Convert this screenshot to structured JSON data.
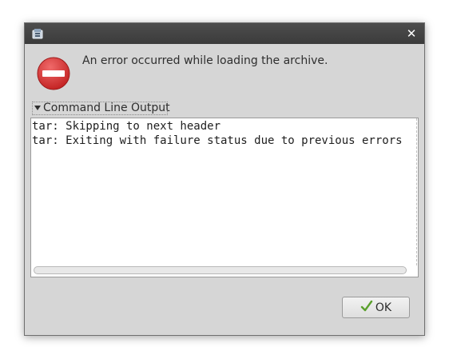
{
  "dialog": {
    "message": "An error occurred while loading the archive.",
    "expander_label": "Command Line Output",
    "expanded": true,
    "output_lines": [
      "tar: Skipping to next header",
      "tar: Exiting with failure status due to previous errors"
    ],
    "ok_label": "OK"
  },
  "icons": {
    "app": "archive-app-icon",
    "close": "close-icon",
    "error": "error-stop-icon",
    "ok": "checkmark-icon"
  },
  "colors": {
    "titlebar": "#3f3f3f",
    "window_bg": "#d6d6d6",
    "error_red": "#d43a3a",
    "check_green": "#5aa02c"
  }
}
